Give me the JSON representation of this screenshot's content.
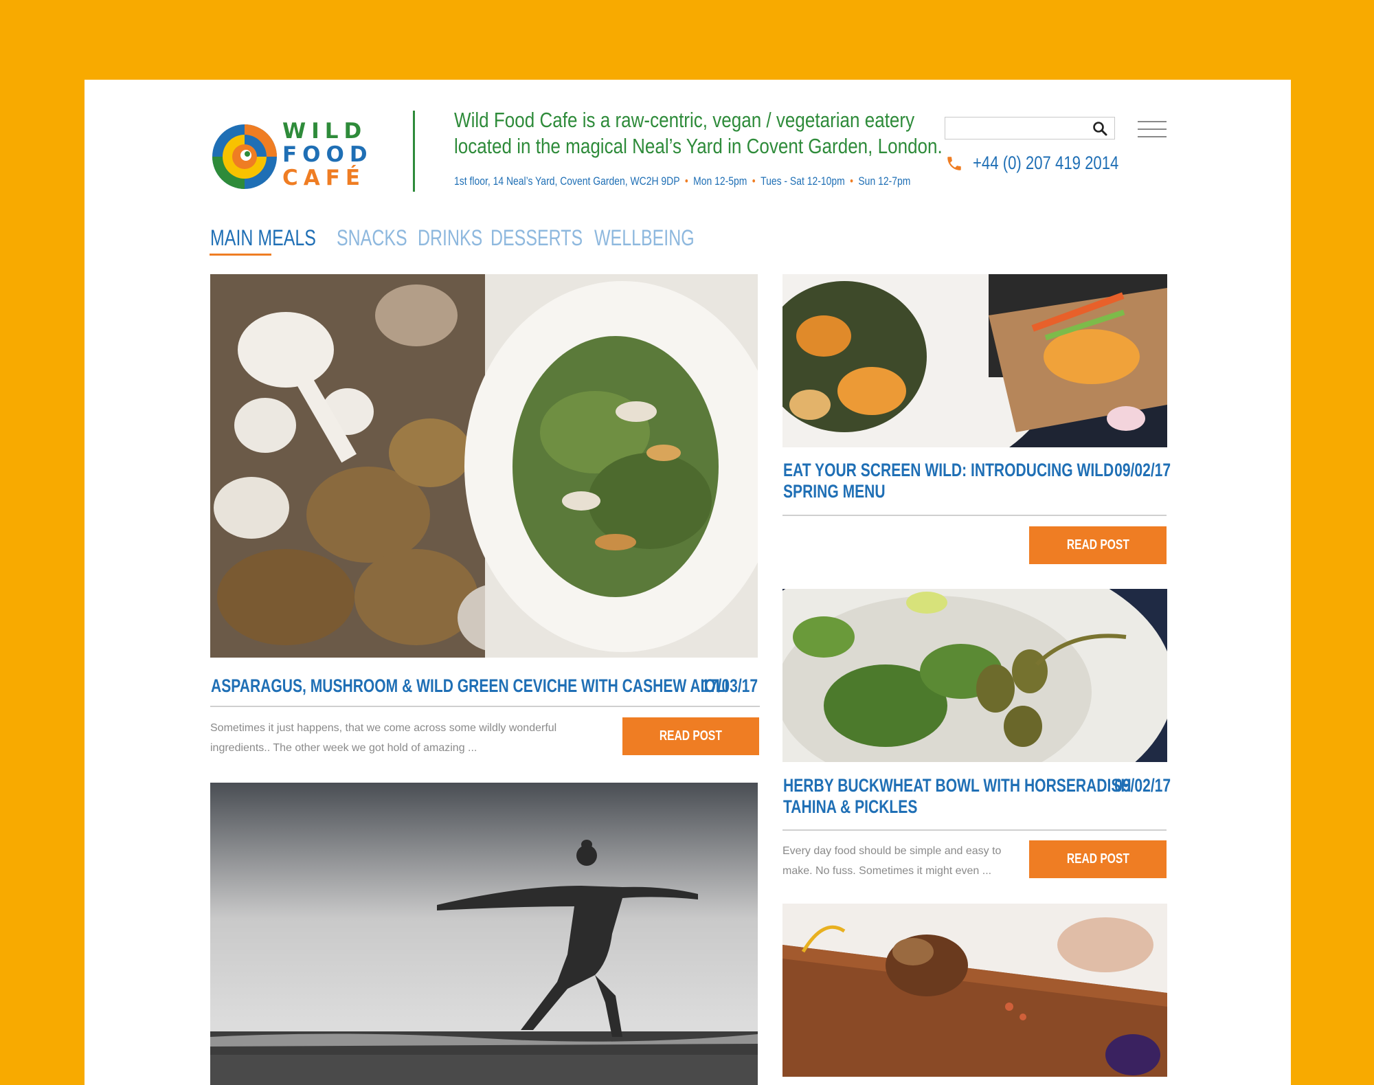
{
  "brand": {
    "logo_lines": [
      "WILD",
      "FOOD",
      "CAFÉ"
    ],
    "tagline_line1": "Wild Food Cafe is a raw-centric, vegan / vegetarian eatery",
    "tagline_line2": "located in the magical Neal’s Yard in Covent Garden, London.",
    "address": "1st floor, 14 Neal’s Yard, Covent Garden, WC2H 9DP",
    "hours": [
      "Mon 12-5pm",
      "Tues - Sat 12-10pm",
      "Sun 12-7pm"
    ]
  },
  "header": {
    "search_value": "",
    "phone": "+44 (0) 207 419 2014"
  },
  "tabs": [
    {
      "label": "MAIN MEALS",
      "active": true
    },
    {
      "label": "SNACKS",
      "active": false
    },
    {
      "label": "DRINKS",
      "active": false
    },
    {
      "label": "DESSERTS",
      "active": false
    },
    {
      "label": "WELLBEING",
      "active": false
    }
  ],
  "posts": [
    {
      "title": "ASPARAGUS, MUSHROOM & WILD GREEN CEVICHE WITH CASHEW AIOLI",
      "date": "17/03/17",
      "excerpt_line1": "Sometimes it just happens, that we come across some wildly wonderful",
      "excerpt_line2": "ingredients.. The other week we got hold of amazing ...",
      "button": "READ POST"
    },
    {
      "title_line1": "EAT YOUR SCREEN WILD: INTRODUCING WILD",
      "title_line2": "SPRING MENU",
      "date": "09/02/17",
      "button": "READ POST"
    },
    {
      "title_line1": "HERBY BUCKWHEAT BOWL WITH HORSERADISH",
      "title_line2": "TAHINA & PICKLES",
      "date": "09/02/17",
      "excerpt_line1": "Every day food should be simple and easy to",
      "excerpt_line2": "make. No fuss. Sometimes it might even ...",
      "button": "READ POST"
    }
  ],
  "colors": {
    "background": "#F8AA00",
    "green": "#2E8B3A",
    "blue": "#1F6FB5",
    "light_blue": "#8EB8DE",
    "orange": "#EF7D23"
  }
}
